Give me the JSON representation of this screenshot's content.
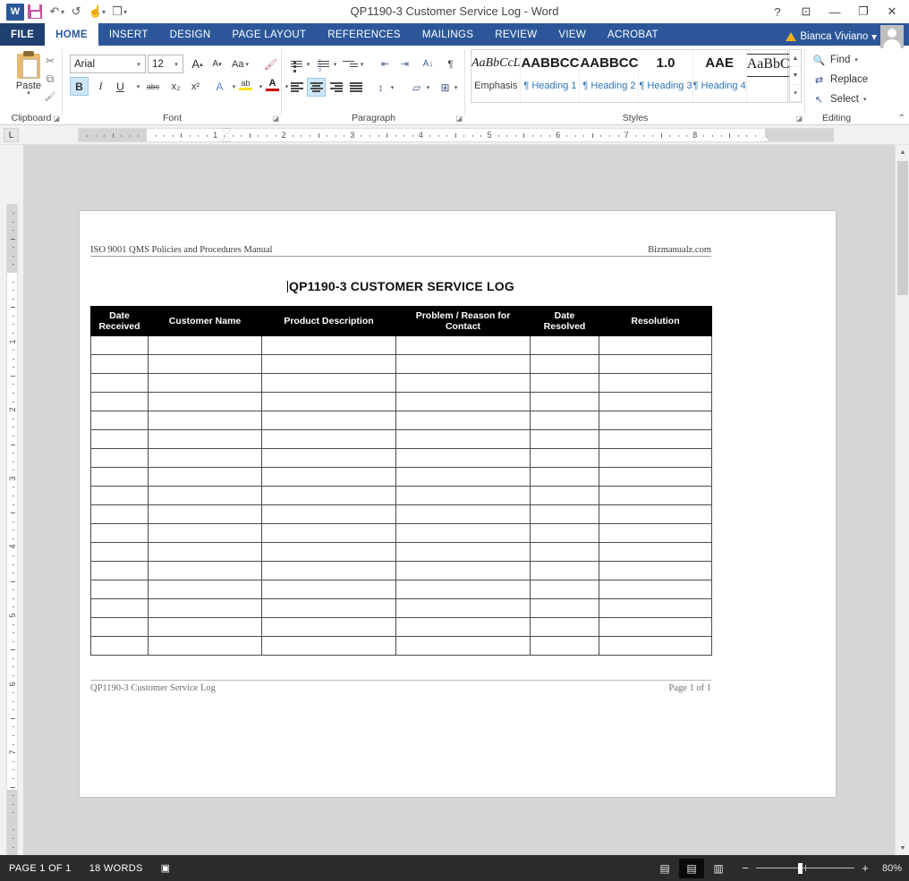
{
  "window": {
    "title": "QP1190-3 Customer Service Log - Word",
    "quick_access": [
      {
        "name": "word-logo",
        "label": "W"
      },
      {
        "name": "save-icon",
        "label": ""
      },
      {
        "name": "undo-icon",
        "label": "↶"
      },
      {
        "name": "redo-icon",
        "label": "↺"
      },
      {
        "name": "touch-mode-icon",
        "label": "☝"
      },
      {
        "name": "repeat-icon",
        "label": "❐"
      }
    ],
    "controls": {
      "help": "?",
      "ribbon_display": "⊡",
      "minimize": "—",
      "restore": "❐",
      "close": "✕"
    },
    "account": {
      "warning": "!",
      "user": "Bianca Viviano",
      "dropdown": "▾"
    }
  },
  "ribbon": {
    "tabs": [
      {
        "label": "FILE",
        "active": false,
        "file": true
      },
      {
        "label": "HOME",
        "active": true,
        "file": false
      },
      {
        "label": "INSERT",
        "active": false,
        "file": false
      },
      {
        "label": "DESIGN",
        "active": false,
        "file": false
      },
      {
        "label": "PAGE LAYOUT",
        "active": false,
        "file": false
      },
      {
        "label": "REFERENCES",
        "active": false,
        "file": false
      },
      {
        "label": "MAILINGS",
        "active": false,
        "file": false
      },
      {
        "label": "REVIEW",
        "active": false,
        "file": false
      },
      {
        "label": "VIEW",
        "active": false,
        "file": false
      },
      {
        "label": "ACROBAT",
        "active": false,
        "file": false
      }
    ],
    "clipboard": {
      "group_label": "Clipboard",
      "paste_label": "Paste",
      "paste_arrow": "▾",
      "cut": "✂",
      "copy": "⧉",
      "format_painter": "🖌"
    },
    "font": {
      "group_label": "Font",
      "font_name": "Arial",
      "font_size": "12",
      "grow_font": "A",
      "shrink_font": "A",
      "change_case": "Aa",
      "clear_formatting": "A",
      "bold": "B",
      "italic": "I",
      "underline": "U",
      "strikethrough": "abc",
      "subscript": "x₂",
      "superscript": "x²",
      "text_effects": "A",
      "highlight": "ab",
      "font_color": "A",
      "dropdown": "▾"
    },
    "paragraph": {
      "group_label": "Paragraph",
      "bullets": "▤",
      "numbering": "▤",
      "multilevel": "▤",
      "decrease_indent": "⇤",
      "increase_indent": "⇥",
      "sort": "A↓",
      "show_marks": "¶",
      "align_left": "≡",
      "align_center": "≡",
      "align_right": "≡",
      "justify": "≡",
      "line_spacing": "↕",
      "shading": "▱",
      "borders": "⊞"
    },
    "styles": {
      "group_label": "Styles",
      "items": [
        {
          "preview": "AaBbCcL",
          "name": "Emphasis"
        },
        {
          "preview": "AABBCC",
          "name": "¶ Heading 1"
        },
        {
          "preview": "AABBCC",
          "name": "¶ Heading 2"
        },
        {
          "preview": "1.0",
          "name": "¶ Heading 3"
        },
        {
          "preview": "AAE",
          "name": "¶ Heading 4"
        },
        {
          "preview": "AaBbC",
          "name": ""
        }
      ],
      "scroll_up": "▲",
      "scroll_down": "▼",
      "more": "▾"
    },
    "editing": {
      "group_label": "Editing",
      "find": "Find",
      "find_arrow": "▾",
      "replace": "Replace",
      "select": "Select",
      "select_arrow": "▾",
      "collapse_ribbon": "⌃"
    }
  },
  "ruler": {
    "tab_selector": "L",
    "h_numbers": [
      "1",
      "1",
      "2",
      "3",
      "4",
      "5",
      "6",
      "7",
      "8"
    ],
    "v_numbers": [
      "1",
      "1",
      "2",
      "3",
      "4",
      "5",
      "6",
      "7"
    ]
  },
  "document": {
    "header": {
      "left": "ISO 9001 QMS Policies and Procedures Manual",
      "right": "Bizmanualz.com"
    },
    "title": "QP1190-3 CUSTOMER SERVICE LOG",
    "footer": {
      "left": "QP1190-3 Customer Service Log",
      "right": "Page 1 of 1"
    },
    "table": {
      "columns": [
        {
          "label": "Date Received",
          "width": 64
        },
        {
          "label": "Customer Name",
          "width": 127
        },
        {
          "label": "Product Description",
          "width": 150
        },
        {
          "label": "Problem / Reason for Contact",
          "width": 150
        },
        {
          "label": "Date Resolved",
          "width": 77
        },
        {
          "label": "Resolution",
          "width": 126
        }
      ],
      "empty_row_count": 17
    }
  },
  "status_bar": {
    "page_info": "PAGE 1 OF 1",
    "word_count": "18 WORDS",
    "proofing_icon": "▣",
    "views": [
      {
        "name": "read-mode",
        "glyph": "▤",
        "active": false
      },
      {
        "name": "print-layout",
        "glyph": "▤",
        "active": true
      },
      {
        "name": "web-layout",
        "glyph": "▥",
        "active": false
      }
    ],
    "zoom_out": "−",
    "zoom_in": "+",
    "zoom_level": "80%"
  },
  "scrollbar": {
    "up_arrow": "▲",
    "down_arrow": "▼"
  }
}
